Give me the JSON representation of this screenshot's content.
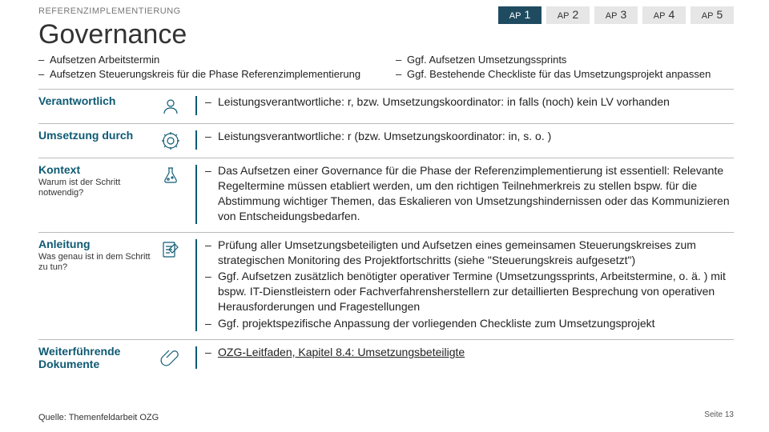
{
  "header": {
    "super_title": "REFERENZIMPLEMENTIERUNG",
    "title": "Governance",
    "tabs": [
      {
        "prefix": "AP",
        "num": "1",
        "active": true
      },
      {
        "prefix": "AP",
        "num": "2",
        "active": false
      },
      {
        "prefix": "AP",
        "num": "3",
        "active": false
      },
      {
        "prefix": "AP",
        "num": "4",
        "active": false
      },
      {
        "prefix": "AP",
        "num": "5",
        "active": false
      }
    ]
  },
  "bullets": {
    "left": [
      "Aufsetzen Arbeitstermin",
      "Aufsetzen Steuerungskreis für die Phase Referenzimplementierung"
    ],
    "right": [
      "Ggf. Aufsetzen Umsetzungssprints",
      "Ggf. Bestehende Checkliste für das Umsetzungsprojekt anpassen"
    ]
  },
  "sections": {
    "verantwortlich": {
      "label": "Verantwortlich",
      "items": [
        "Leistungsverantwortliche: r, bzw. Umsetzungskoordinator: in falls (noch) kein LV vorhanden"
      ]
    },
    "umsetzung": {
      "label": "Umsetzung durch",
      "items": [
        "Leistungsverantwortliche: r (bzw. Umsetzungskoordinator: in, s. o. )"
      ]
    },
    "kontext": {
      "label": "Kontext",
      "sub": "Warum ist der Schritt notwendig?",
      "items": [
        "Das Aufsetzen einer Governance für die Phase der Referenzimplementierung ist essentiell: Relevante Regeltermine müssen etabliert werden, um den richtigen Teilnehmerkreis zu stellen bspw. für die Abstimmung wichtiger Themen, das Eskalieren von Umsetzungshindernissen oder das Kommunizieren von Entscheidungsbedarfen."
      ]
    },
    "anleitung": {
      "label": "Anleitung",
      "sub": "Was genau ist in dem Schritt zu tun?",
      "items": [
        "Prüfung aller Umsetzungsbeteiligten und Aufsetzen eines gemeinsamen Steuerungskreises zum strategischen Monitoring des Projektfortschritts (siehe \"Steuerungskreis aufgesetzt\")",
        "Ggf. Aufsetzen zusätzlich benötigter operativer Termine (Umsetzungssprints, Arbeitstermine, o. ä. ) mit bspw. IT-Dienstleistern oder Fachverfahrensherstellern zur detaillierten Besprechung von operativen Herausforderungen und Fragestellungen",
        "Ggf. projektspezifische Anpassung der vorliegenden Checkliste zum Umsetzungsprojekt"
      ]
    },
    "dokumente": {
      "label": "Weiterführende Dokumente",
      "link": "OZG-Leitfaden, Kapitel 8.4: Umsetzungsbeteiligte"
    }
  },
  "footer": {
    "source": "Quelle: Themenfeldarbeit OZG",
    "page_label": "Seite",
    "page_num": "13"
  },
  "colors": {
    "accent": "#0e5a73",
    "tab_active": "#1f4b60"
  }
}
